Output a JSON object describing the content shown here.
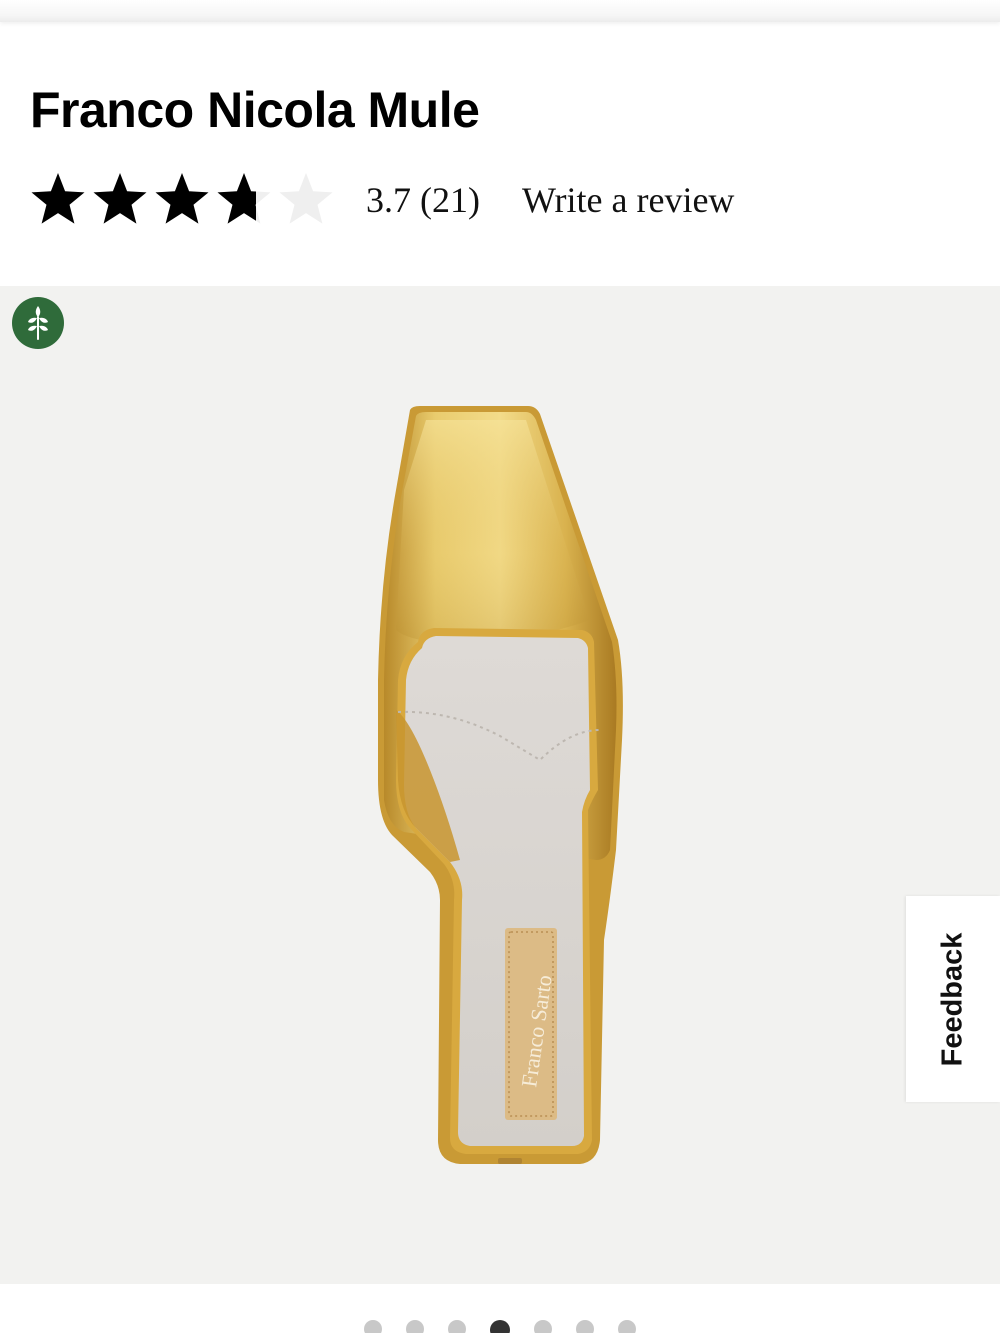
{
  "product": {
    "title": "Franco Nicola Mule"
  },
  "rating": {
    "value": 3.7,
    "max": 5,
    "display": "3.7 (21)",
    "review_link_label": "Write a review"
  },
  "gallery": {
    "image_count": 7,
    "active_index": 3,
    "badge_icon": "leaf-sustainable-icon",
    "product_image_alt": "Franco Sarto",
    "insole_logo": "Franco Sarto"
  },
  "feedback": {
    "label": "Feedback"
  },
  "colors": {
    "eco_badge": "#2f6b3a",
    "gold": "#d4ac3f",
    "gallery_bg": "#f2f2f0"
  }
}
